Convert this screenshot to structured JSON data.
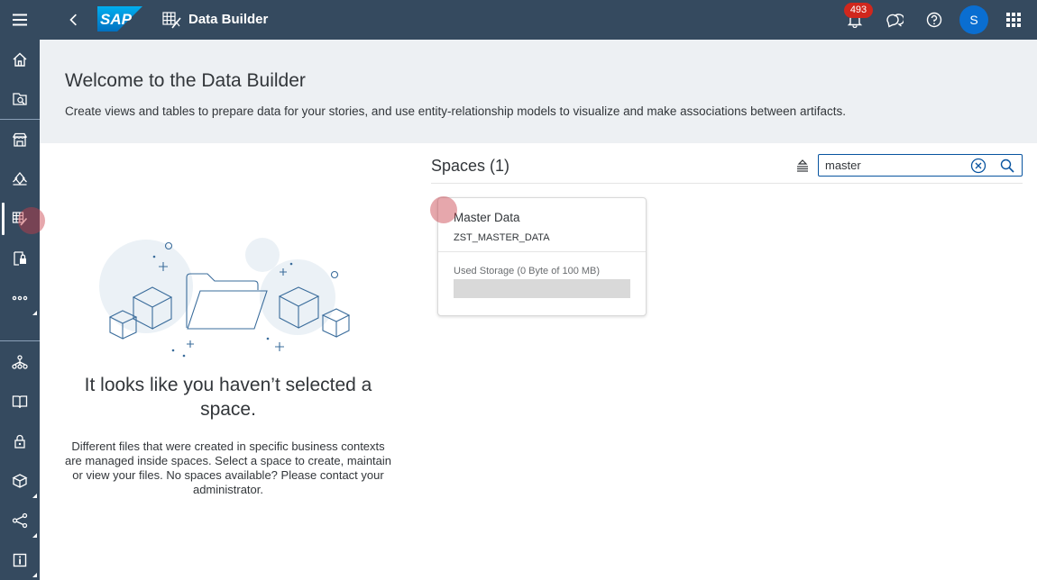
{
  "shell": {
    "brand": "SAP",
    "app_title": "Data Builder",
    "notification_count": "493",
    "avatar_initial": "S"
  },
  "nav_rail": {
    "items": [
      {
        "icon": "menu-icon"
      },
      {
        "icon": "home-icon"
      },
      {
        "icon": "repository-explorer-icon"
      },
      {
        "icon": "marketplace-icon"
      },
      {
        "icon": "business-builder-icon"
      },
      {
        "icon": "data-builder-icon",
        "active": true
      },
      {
        "icon": "data-access-control-icon"
      },
      {
        "icon": "more-icon"
      },
      {
        "icon": "connections-icon"
      },
      {
        "icon": "catalog-icon"
      },
      {
        "icon": "security-icon"
      },
      {
        "icon": "transport-icon"
      },
      {
        "icon": "data-integration-icon"
      },
      {
        "icon": "system-information-icon"
      }
    ]
  },
  "header": {
    "title": "Welcome to the Data Builder",
    "subtitle": "Create views and tables to prepare data for your stories, and use entity-relationship models to visualize and make associations between artifacts."
  },
  "empty_state": {
    "title": "It looks like you haven’t selected a space.",
    "description": "Different files that were created in specific business contexts are managed inside spaces. Select a space to create, maintain or view your files. No spaces available? Please contact your administrator."
  },
  "spaces": {
    "title": "Spaces (1)",
    "search_value": "master",
    "cards": [
      {
        "name": "Master Data",
        "business_id": "ZST_MASTER_DATA",
        "storage_label": "Used Storage (0 Byte of 100 MB)",
        "storage_used_fraction": 0
      }
    ]
  },
  "colors": {
    "shell_bg": "#354a5f",
    "header_band_bg": "#edf0f3",
    "accent": "#0a6ed1",
    "badge_red": "#d0271d"
  }
}
